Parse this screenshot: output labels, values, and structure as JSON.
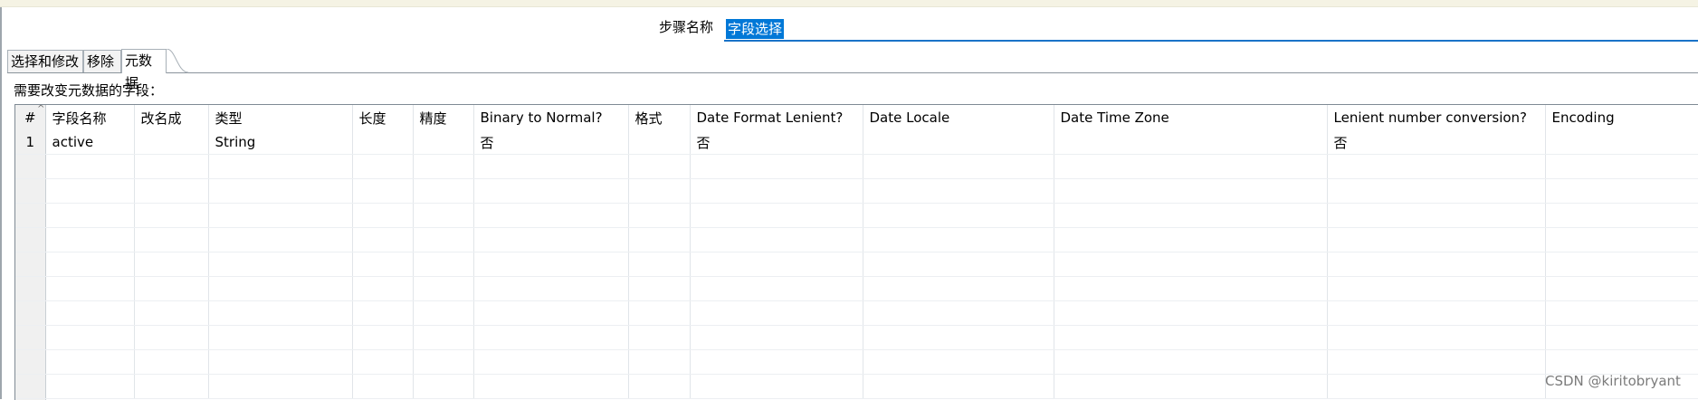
{
  "header": {
    "step_name_label": "步骤名称",
    "step_name_value": "字段选择"
  },
  "tabs": [
    {
      "label": "选择和修改",
      "active": false
    },
    {
      "label": "移除",
      "active": false
    },
    {
      "label": "元数据",
      "active": true
    }
  ],
  "section": {
    "fields_label": "需要改变元数据的字段："
  },
  "table": {
    "sort_indicator": "^",
    "columns": [
      "#",
      "字段名称",
      "改名成",
      "类型",
      "长度",
      "精度",
      "Binary to Normal?",
      "格式",
      "Date Format Lenient?",
      "Date Locale",
      "Date Time Zone",
      "Lenient number conversion?",
      "Encoding"
    ],
    "rows": [
      [
        "1",
        "active",
        "",
        "String",
        "",
        "",
        "否",
        "",
        "否",
        "",
        "",
        "否",
        ""
      ],
      [
        "",
        "",
        "",
        "",
        "",
        "",
        "",
        "",
        "",
        "",
        "",
        "",
        ""
      ],
      [
        "",
        "",
        "",
        "",
        "",
        "",
        "",
        "",
        "",
        "",
        "",
        "",
        ""
      ],
      [
        "",
        "",
        "",
        "",
        "",
        "",
        "",
        "",
        "",
        "",
        "",
        "",
        ""
      ],
      [
        "",
        "",
        "",
        "",
        "",
        "",
        "",
        "",
        "",
        "",
        "",
        "",
        ""
      ],
      [
        "",
        "",
        "",
        "",
        "",
        "",
        "",
        "",
        "",
        "",
        "",
        "",
        ""
      ],
      [
        "",
        "",
        "",
        "",
        "",
        "",
        "",
        "",
        "",
        "",
        "",
        "",
        ""
      ],
      [
        "",
        "",
        "",
        "",
        "",
        "",
        "",
        "",
        "",
        "",
        "",
        "",
        ""
      ],
      [
        "",
        "",
        "",
        "",
        "",
        "",
        "",
        "",
        "",
        "",
        "",
        "",
        ""
      ],
      [
        "",
        "",
        "",
        "",
        "",
        "",
        "",
        "",
        "",
        "",
        "",
        "",
        ""
      ],
      [
        "",
        "",
        "",
        "",
        "",
        "",
        "",
        "",
        "",
        "",
        "",
        "",
        ""
      ]
    ]
  },
  "watermark": "CSDN @kiritobryant",
  "colors": {
    "selection": "#0078d7",
    "input_underline": "#1a73c8"
  }
}
